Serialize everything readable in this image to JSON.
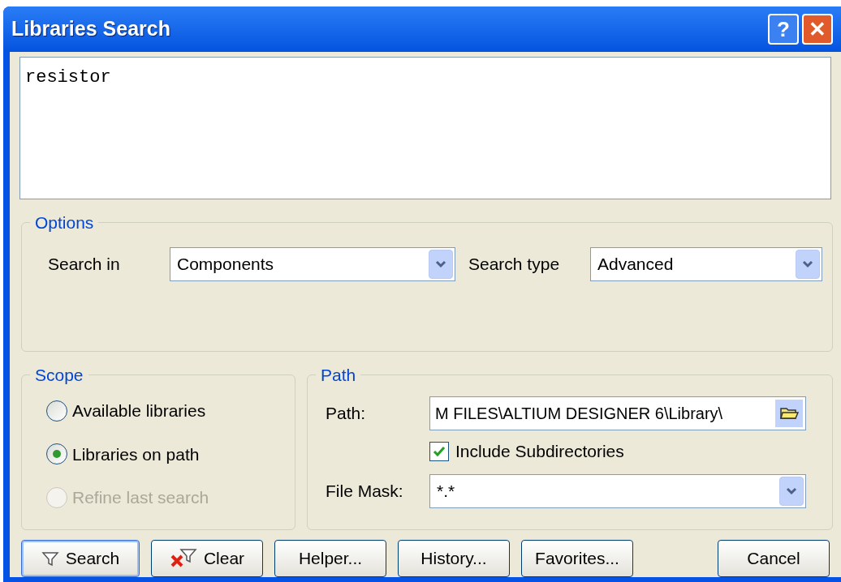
{
  "window": {
    "title": "Libraries Search",
    "buttons": [
      {
        "kind": "help",
        "label": "?"
      },
      {
        "kind": "close",
        "label": "✕"
      }
    ]
  },
  "query": {
    "value": "resistor"
  },
  "options": {
    "title": "Options",
    "search_in": {
      "label": "Search in",
      "value": "Components"
    },
    "search_type": {
      "label": "Search type",
      "value": "Advanced"
    }
  },
  "scope": {
    "title": "Scope",
    "choices": [
      {
        "label": "Available libraries",
        "selected": false,
        "disabled": false
      },
      {
        "label": "Libraries on path",
        "selected": true,
        "disabled": false
      },
      {
        "label": "Refine last search",
        "selected": false,
        "disabled": true
      }
    ]
  },
  "path": {
    "title": "Path",
    "path_label": "Path:",
    "path_value": "M FILES\\ALTIUM DESIGNER 6\\Library\\",
    "include_subdirectories": {
      "label": "Include Subdirectories",
      "checked": true
    },
    "mask_label": "File Mask:",
    "mask_value": "*.*"
  },
  "buttons": [
    {
      "label": "Search",
      "kind": "search",
      "default": true
    },
    {
      "label": "Clear",
      "kind": "clear",
      "default": false
    },
    {
      "label": "Helper...",
      "kind": "plain",
      "default": false
    },
    {
      "label": "History...",
      "kind": "plain",
      "default": false
    },
    {
      "label": "Favorites...",
      "kind": "plain",
      "default": false
    },
    {
      "label": "Cancel",
      "kind": "cancel",
      "default": false
    }
  ]
}
